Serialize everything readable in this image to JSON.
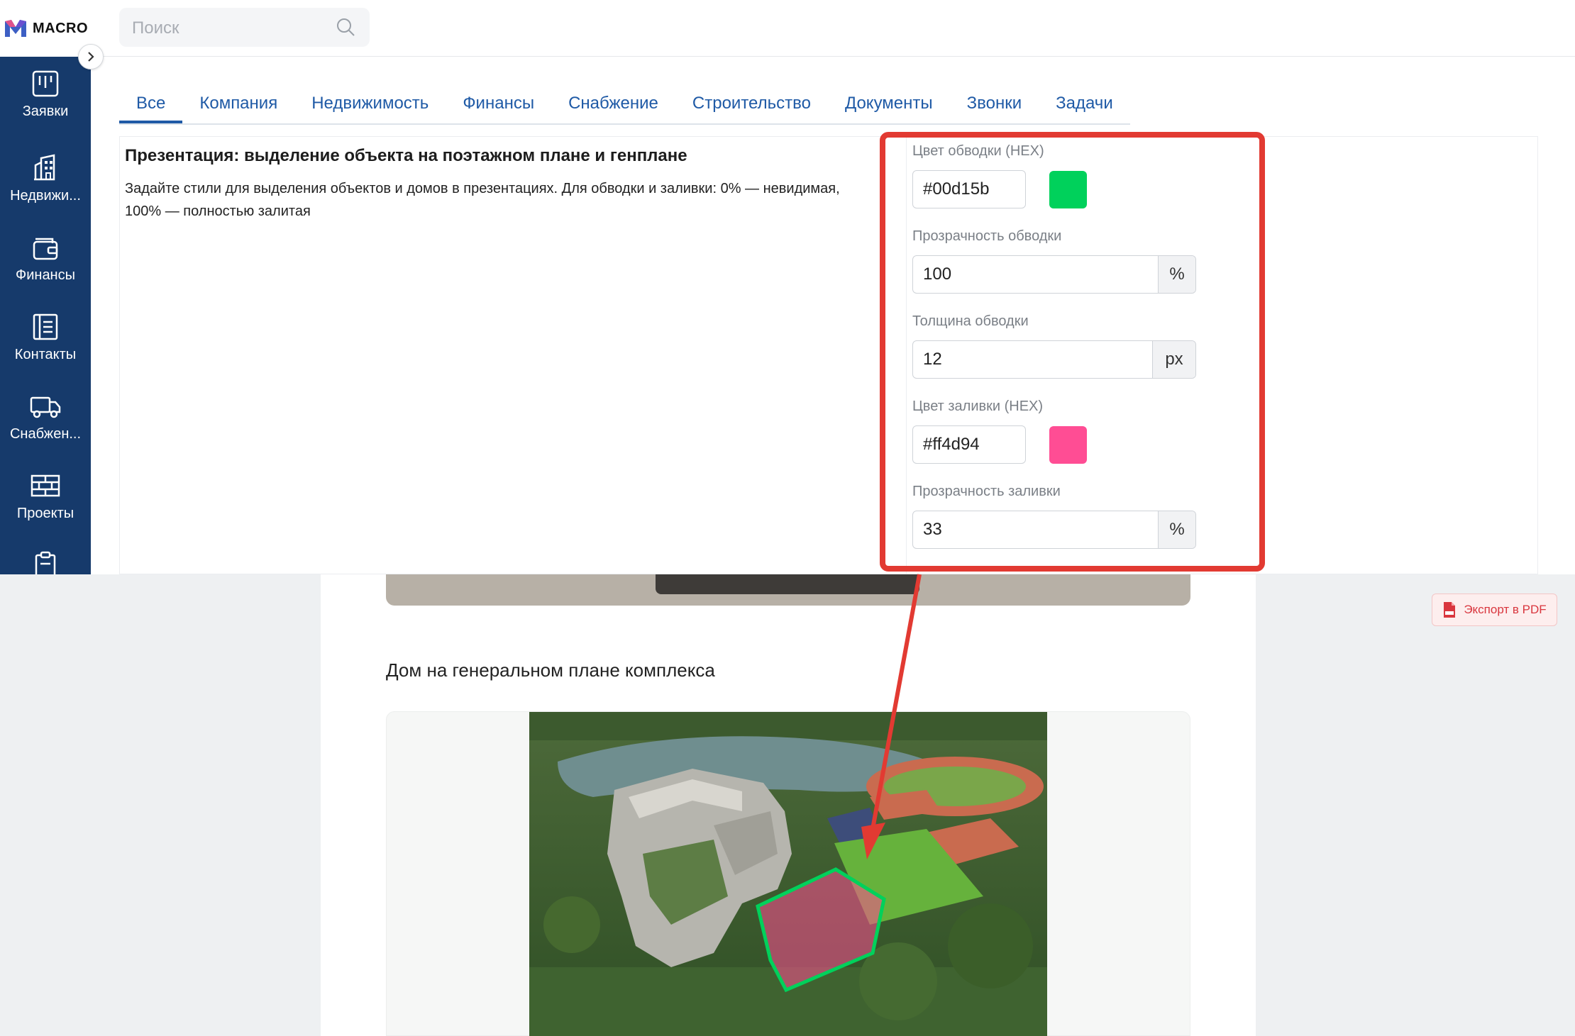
{
  "brand": {
    "name": "MACRO"
  },
  "search": {
    "placeholder": "Поиск"
  },
  "sidebar": {
    "items": [
      {
        "label": "Заявки",
        "icon": "requests-icon"
      },
      {
        "label": "Недвижи...",
        "icon": "building-icon"
      },
      {
        "label": "Финансы",
        "icon": "wallet-icon"
      },
      {
        "label": "Контакты",
        "icon": "contacts-icon"
      },
      {
        "label": "Снабжен...",
        "icon": "truck-icon"
      },
      {
        "label": "Проекты",
        "icon": "bricks-icon"
      }
    ]
  },
  "tabs": [
    {
      "label": "Все",
      "active": true
    },
    {
      "label": "Компания"
    },
    {
      "label": "Недвижимость"
    },
    {
      "label": "Финансы"
    },
    {
      "label": "Снабжение"
    },
    {
      "label": "Строительство"
    },
    {
      "label": "Документы"
    },
    {
      "label": "Звонки"
    },
    {
      "label": "Задачи"
    }
  ],
  "setting": {
    "title": "Презентация: выделение объекта на поэтажном плане и генплане",
    "description": "Задайте стили для выделения объектов и домов в презентациях. Для обводки и заливки: 0% — невидимая, 100% — полностью залитая",
    "stroke_color": {
      "label": "Цвет обводки (HEX)",
      "value": "#00d15b",
      "swatch": "#00d15b"
    },
    "stroke_opacity": {
      "label": "Прозрачность обводки",
      "value": "100",
      "unit": "%"
    },
    "stroke_width": {
      "label": "Толщина обводки",
      "value": "12",
      "unit": "px"
    },
    "fill_color": {
      "label": "Цвет заливки (HEX)",
      "value": "#ff4d94",
      "swatch": "#ff4d94"
    },
    "fill_opacity": {
      "label": "Прозрачность заливки",
      "value": "33",
      "unit": "%"
    }
  },
  "preview": {
    "export_label": "Экспорт в PDF",
    "section_title": "Дом на генеральном плане комплекса"
  },
  "colors": {
    "sidebar": "#163a6b",
    "tab_text": "#1f5aa6",
    "highlight": "#e23a32"
  }
}
